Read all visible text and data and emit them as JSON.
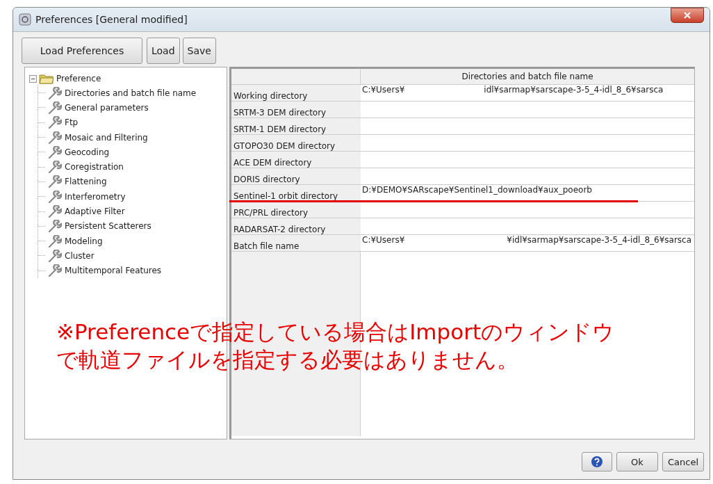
{
  "window": {
    "title": "Preferences [General modified]"
  },
  "toolbar": {
    "buttons": [
      "Load Preferences",
      "Load",
      "Save"
    ]
  },
  "tree": {
    "label": "Preference",
    "expanded": true,
    "children": [
      {
        "label": "Directories and batch file name"
      },
      {
        "label": "General parameters"
      },
      {
        "label": "Ftp"
      },
      {
        "label": "Mosaic and Filtering"
      },
      {
        "label": "Geocoding"
      },
      {
        "label": "Coregistration"
      },
      {
        "label": "Flattening"
      },
      {
        "label": "Interferometry"
      },
      {
        "label": "Adaptive Filter"
      },
      {
        "label": "Persistent Scatterers"
      },
      {
        "label": "Modeling"
      },
      {
        "label": "Cluster"
      },
      {
        "label": "Multitemporal Features"
      }
    ]
  },
  "table": {
    "column_header": "Directories and batch file name",
    "rows": [
      {
        "label": "Working directory",
        "value_parts": [
          "C:¥Users¥",
          "idl¥sarmap¥sarscape-3-5_4-idl_8_6¥sarsca"
        ]
      },
      {
        "label": "SRTM-3 DEM directory",
        "value_parts": []
      },
      {
        "label": "SRTM-1 DEM directory",
        "value_parts": []
      },
      {
        "label": "GTOPO30 DEM directory",
        "value_parts": []
      },
      {
        "label": "ACE DEM directory",
        "value_parts": []
      },
      {
        "label": "DORIS directory",
        "value_parts": []
      },
      {
        "label": "Sentinel-1 orbit directory",
        "value_parts": [
          "D:¥DEMO¥SARscape¥Sentinel1_download¥aux_poeorb"
        ],
        "underlined": true
      },
      {
        "label": "PRC/PRL directory",
        "value_parts": []
      },
      {
        "label": "RADARSAT-2 directory",
        "value_parts": []
      },
      {
        "label": "Batch file name",
        "value_parts": [
          "C:¥Users¥",
          "¥idl¥sarmap¥sarscape-3-5_4-idl_8_6¥sarsca"
        ]
      }
    ]
  },
  "annotation": {
    "lines": [
      "※Preferenceで指定している場合はImportのウィンドウ",
      "で軌道ファイルを指定する必要はありません。"
    ]
  },
  "footer": {
    "buttons": [
      "Ok",
      "Cancel"
    ]
  }
}
